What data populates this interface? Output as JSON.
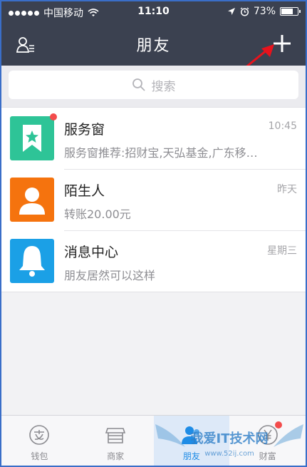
{
  "status_bar": {
    "carrier": "中国移动",
    "time": "11:10",
    "battery": "73%",
    "battery_level": 0.73
  },
  "nav": {
    "title": "朋友"
  },
  "search": {
    "placeholder": "搜索"
  },
  "conversations": [
    {
      "title": "服务窗",
      "subtitle": "服务窗推荐:招财宝,天弘基金,广东移…",
      "time": "10:45",
      "color": "#2ec497",
      "icon": "bookmark-star-icon",
      "unread": true
    },
    {
      "title": "陌生人",
      "subtitle": "转账20.00元",
      "time": "昨天",
      "color": "#f5730e",
      "icon": "person-icon",
      "unread": false
    },
    {
      "title": "消息中心",
      "subtitle": "朋友居然可以这样",
      "time": "星期三",
      "color": "#1ba0e6",
      "icon": "bell-icon",
      "unread": false
    }
  ],
  "tabbar": {
    "tabs": [
      {
        "label": "钱包",
        "icon": "wallet-icon",
        "active": false,
        "badge": false
      },
      {
        "label": "商家",
        "icon": "store-icon",
        "active": false,
        "badge": false
      },
      {
        "label": "朋友",
        "icon": "friends-icon",
        "active": true,
        "badge": false
      },
      {
        "label": "财富",
        "icon": "wealth-icon",
        "active": false,
        "badge": true
      }
    ]
  },
  "watermark": {
    "text": "我爱IT技术网",
    "url": "www.52ij.com"
  },
  "colors": {
    "nav_bg": "#3b4150",
    "accent_blue": "#1e8ce6",
    "badge_red": "#f34c4c",
    "arrow_red": "#e8121c"
  }
}
